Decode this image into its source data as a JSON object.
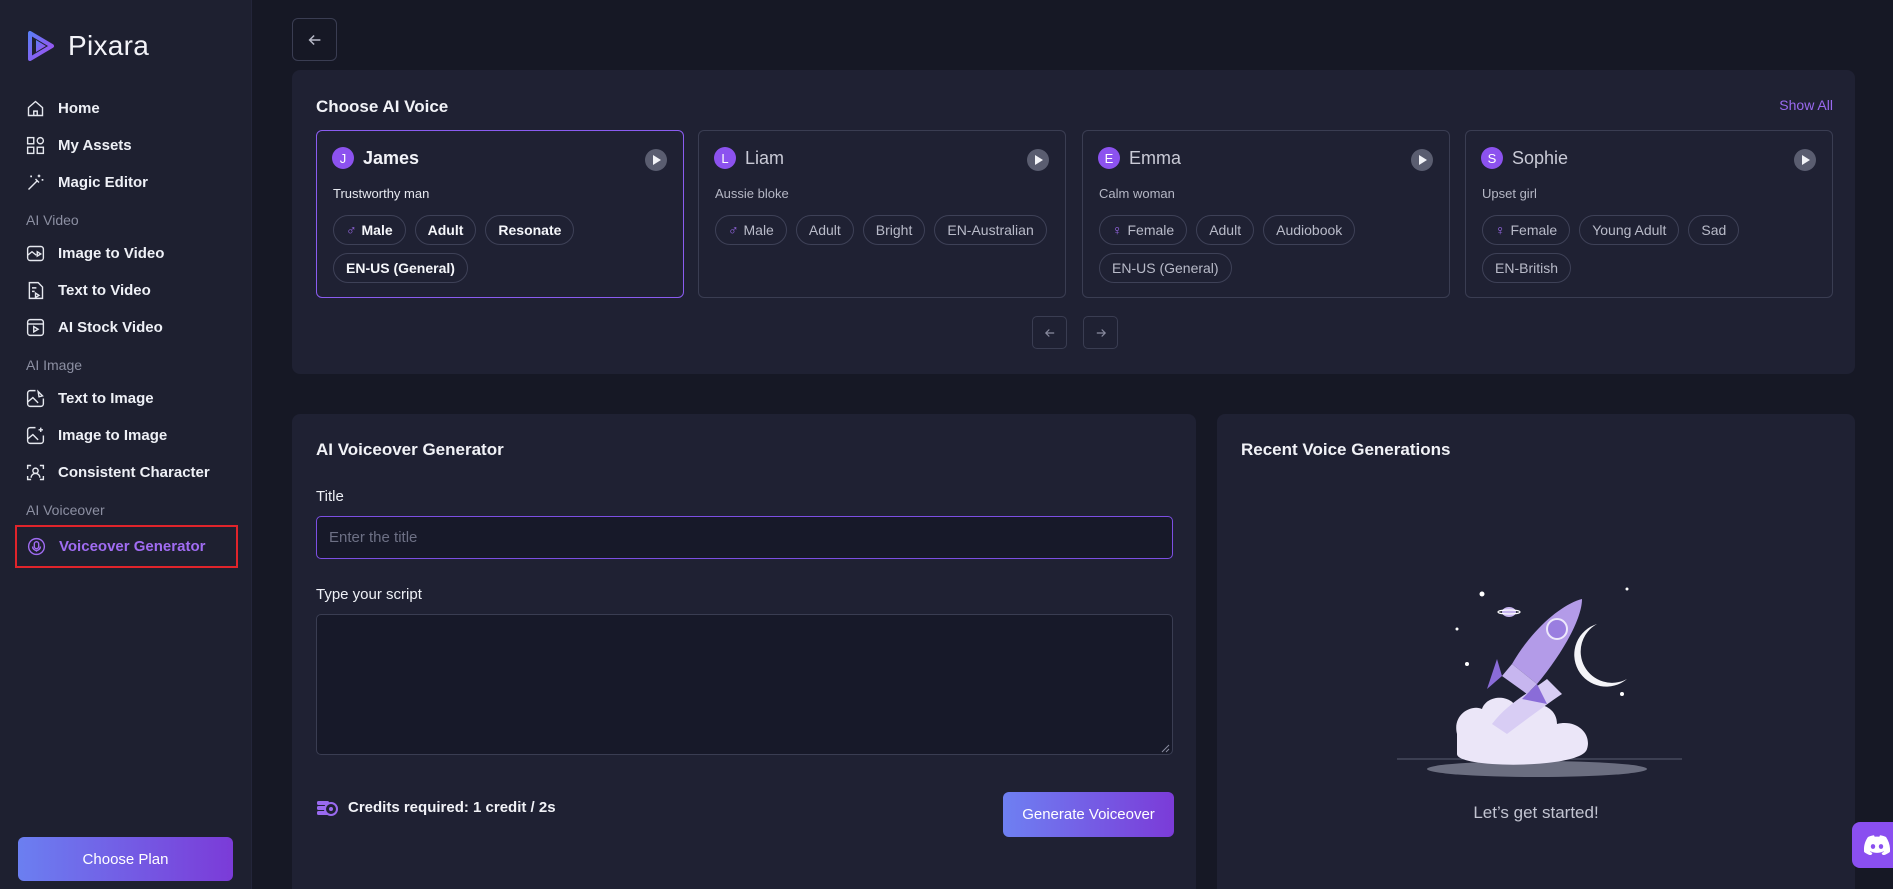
{
  "app": {
    "name": "Pixara"
  },
  "sidebar": {
    "items": [
      {
        "label": "Home",
        "icon": "home-icon"
      },
      {
        "label": "My Assets",
        "icon": "assets-icon"
      },
      {
        "label": "Magic Editor",
        "icon": "magic-wand-icon"
      }
    ],
    "sections": [
      {
        "label": "AI Video",
        "items": [
          {
            "label": "Image to Video",
            "icon": "image-video-icon"
          },
          {
            "label": "Text to Video",
            "icon": "text-video-icon"
          },
          {
            "label": "AI Stock Video",
            "icon": "stock-video-icon"
          }
        ]
      },
      {
        "label": "AI Image",
        "items": [
          {
            "label": "Text to Image",
            "icon": "text-image-icon"
          },
          {
            "label": "Image to Image",
            "icon": "image-image-icon"
          },
          {
            "label": "Consistent Character",
            "icon": "character-icon"
          }
        ]
      },
      {
        "label": "AI Voiceover",
        "items": [
          {
            "label": "Voiceover Generator",
            "icon": "microphone-icon",
            "active": true
          }
        ]
      }
    ],
    "choose_plan": "Choose Plan"
  },
  "voices": {
    "title": "Choose AI Voice",
    "show_all": "Show All",
    "cards": [
      {
        "initial": "J",
        "name": "James",
        "desc": "Trustworthy man",
        "gender": "Male",
        "gender_symbol": "♂",
        "tags": [
          "Adult",
          "Resonate"
        ],
        "locale": "EN-US (General)",
        "selected": true
      },
      {
        "initial": "L",
        "name": "Liam",
        "desc": "Aussie bloke",
        "gender": "Male",
        "gender_symbol": "♂",
        "tags": [
          "Adult",
          "Bright"
        ],
        "locale": "EN-Australian",
        "selected": false
      },
      {
        "initial": "E",
        "name": "Emma",
        "desc": "Calm woman",
        "gender": "Female",
        "gender_symbol": "♀",
        "tags": [
          "Adult",
          "Audiobook"
        ],
        "locale": "EN-US (General)",
        "selected": false
      },
      {
        "initial": "S",
        "name": "Sophie",
        "desc": "Upset girl",
        "gender": "Female",
        "gender_symbol": "♀",
        "tags": [
          "Young Adult",
          "Sad"
        ],
        "locale": "EN-British",
        "selected": false
      }
    ]
  },
  "generator": {
    "title": "AI Voiceover Generator",
    "title_label": "Title",
    "title_placeholder": "Enter the title",
    "title_value": "",
    "script_label": "Type your script",
    "script_value": "",
    "credits": "Credits required: 1 credit / 2s",
    "generate_button": "Generate Voiceover"
  },
  "recent": {
    "title": "Recent Voice Generations",
    "empty_text": "Let’s get started!"
  },
  "colors": {
    "accent": "#8c52ef",
    "background": "#161825",
    "panel": "#1f2133",
    "highlight_box": "#e0242b"
  }
}
